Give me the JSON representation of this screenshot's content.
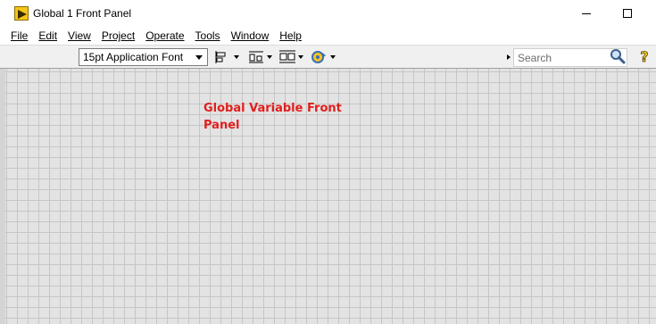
{
  "window": {
    "title": "Global 1 Front Panel"
  },
  "menu": {
    "items": [
      {
        "label": "File",
        "accel_index": 0
      },
      {
        "label": "Edit",
        "accel_index": 0
      },
      {
        "label": "View",
        "accel_index": 0
      },
      {
        "label": "Project",
        "accel_index": 0
      },
      {
        "label": "Operate",
        "accel_index": 0
      },
      {
        "label": "Tools",
        "accel_index": 0
      },
      {
        "label": "Window",
        "accel_index": 0
      },
      {
        "label": "Help",
        "accel_index": 0
      }
    ]
  },
  "toolbar": {
    "font_select_value": "15pt Application Font",
    "buttons": [
      "align-objects-icon",
      "distribute-objects-icon",
      "resize-objects-icon",
      "reorder-icon"
    ],
    "search_placeholder": "Search"
  },
  "canvas": {
    "label": "Global Variable Front Panel",
    "label_color": "#e0201e",
    "grid_color": "#c6c6c6",
    "background_color": "#e3e3e3"
  }
}
